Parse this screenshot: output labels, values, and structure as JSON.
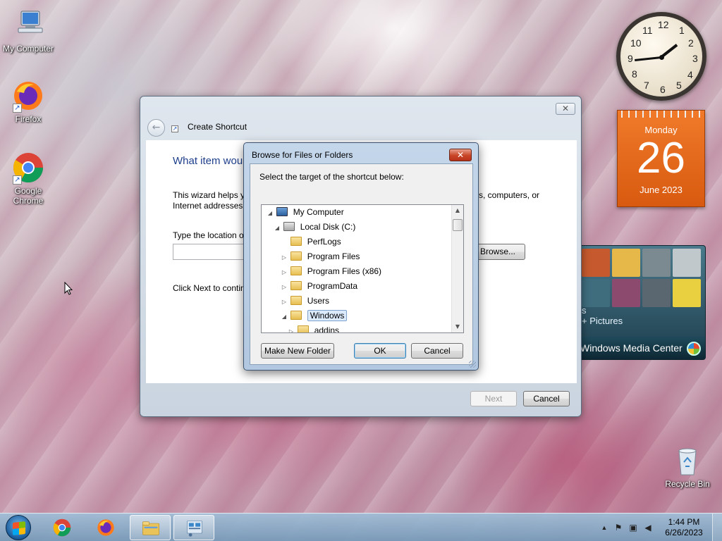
{
  "desktop": {
    "icons": [
      {
        "label": "My Computer",
        "icon": "computer-icon"
      },
      {
        "label": "Firefox",
        "icon": "firefox-icon"
      },
      {
        "label": "Google Chrome",
        "icon": "chrome-icon"
      },
      {
        "label": "Recycle Bin",
        "icon": "recycle-bin-icon"
      }
    ]
  },
  "gadgets": {
    "clock": {
      "numbers": [
        "12",
        "1",
        "2",
        "3",
        "4",
        "5",
        "6",
        "7",
        "8",
        "9",
        "10",
        "11"
      ],
      "time": "1:44"
    },
    "calendar": {
      "day": "Monday",
      "date": "26",
      "month": "June 2023"
    },
    "media_center": {
      "partial_text_1": "s",
      "partial_text_2": "+ Pictures",
      "title": "Windows Media Center"
    }
  },
  "wizard": {
    "title": "Create Shortcut",
    "close_label": "✕",
    "back_label": "←",
    "heading": "What item wou",
    "description": "This wizard helps y",
    "description_line2": "Internet addresses.",
    "description_right": "s, computers, or",
    "location_label": "Type the location o",
    "location_value": "",
    "browse_label": "Browse...",
    "click_next": "Click Next to contin",
    "next_label": "Next",
    "cancel_label": "Cancel"
  },
  "browse_dialog": {
    "title": "Browse for Files or Folders",
    "close_label": "✕",
    "prompt": "Select the target of the shortcut below:",
    "tree": [
      {
        "label": "My Computer",
        "level": 0,
        "expanded": true,
        "icon": "computer-icon"
      },
      {
        "label": "Local Disk (C:)",
        "level": 1,
        "expanded": true,
        "icon": "drive-icon"
      },
      {
        "label": "PerfLogs",
        "level": 2,
        "expanded": null,
        "icon": "folder-icon"
      },
      {
        "label": "Program Files",
        "level": 2,
        "expanded": false,
        "icon": "folder-icon"
      },
      {
        "label": "Program Files (x86)",
        "level": 2,
        "expanded": false,
        "icon": "folder-icon"
      },
      {
        "label": "ProgramData",
        "level": 2,
        "expanded": false,
        "icon": "folder-icon"
      },
      {
        "label": "Users",
        "level": 2,
        "expanded": false,
        "icon": "folder-icon"
      },
      {
        "label": "Windows",
        "level": 2,
        "expanded": true,
        "selected": true,
        "icon": "folder-icon"
      },
      {
        "label": "addins",
        "level": 3,
        "expanded": false,
        "icon": "folder-icon"
      }
    ],
    "new_folder_label": "Make New Folder",
    "ok_label": "OK",
    "cancel_label": "Cancel"
  },
  "taskbar": {
    "items": [
      {
        "name": "chrome",
        "active": false
      },
      {
        "name": "firefox",
        "active": false
      },
      {
        "name": "file-explorer",
        "active": true
      },
      {
        "name": "control-panel",
        "active": true
      }
    ],
    "tray": {
      "time": "1:44 PM",
      "date": "6/26/2023",
      "show_hidden": "▲"
    }
  }
}
